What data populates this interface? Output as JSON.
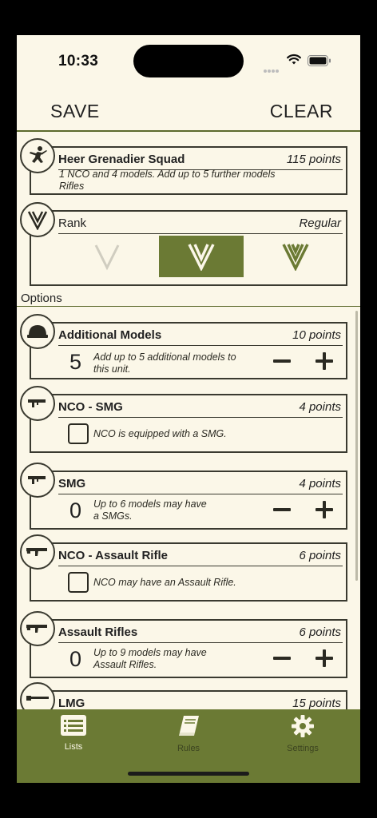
{
  "status": {
    "time": "10:33"
  },
  "nav": {
    "save": "SAVE",
    "clear": "CLEAR"
  },
  "unit": {
    "name": "Heer Grenadier Squad",
    "points": "115 points",
    "desc_line1": "1 NCO and 4 models. Add up to 5 further models",
    "desc_line2": "Rifles",
    "icon": "soldier-icon"
  },
  "rank": {
    "label": "Rank",
    "value": "Regular",
    "options": [
      "inexperienced",
      "regular",
      "veteran"
    ],
    "selected": "regular",
    "icon": "rank-chevron-icon"
  },
  "options_label": "Options",
  "options": [
    {
      "title": "Additional Models",
      "points": "10 points",
      "type": "stepper",
      "count": "5",
      "desc1": "Add up to 5 additional models to",
      "desc2": "this unit.",
      "icon": "helmet-icon"
    },
    {
      "title": "NCO - SMG",
      "points": "4 points",
      "type": "checkbox",
      "desc1": "NCO is equipped with a SMG.",
      "checked": false,
      "icon": "smg-icon"
    },
    {
      "title": "SMG",
      "points": "4 points",
      "type": "stepper",
      "count": "0",
      "desc1": "Up to 6 models may have",
      "desc2": "a SMGs.",
      "icon": "smg-icon"
    },
    {
      "title": "NCO - Assault Rifle",
      "points": "6 points",
      "type": "checkbox",
      "desc1": "NCO may have an Assault Rifle.",
      "checked": false,
      "icon": "assault-rifle-icon"
    },
    {
      "title": "Assault Rifles",
      "points": "6 points",
      "type": "stepper",
      "count": "0",
      "desc1": "Up to 9 models may have",
      "desc2": "Assault Rifles.",
      "icon": "assault-rifle-icon"
    },
    {
      "title": "LMG",
      "points": "15 points",
      "icon": "lmg-icon"
    }
  ],
  "tabs": [
    {
      "label": "Lists",
      "icon": "list-icon",
      "active": true
    },
    {
      "label": "Rules",
      "icon": "book-icon",
      "active": false
    },
    {
      "label": "Settings",
      "icon": "gear-icon",
      "active": false
    }
  ],
  "colors": {
    "accent": "#6b7a34",
    "background": "#fbf7e8",
    "ink": "#2b2a22"
  }
}
